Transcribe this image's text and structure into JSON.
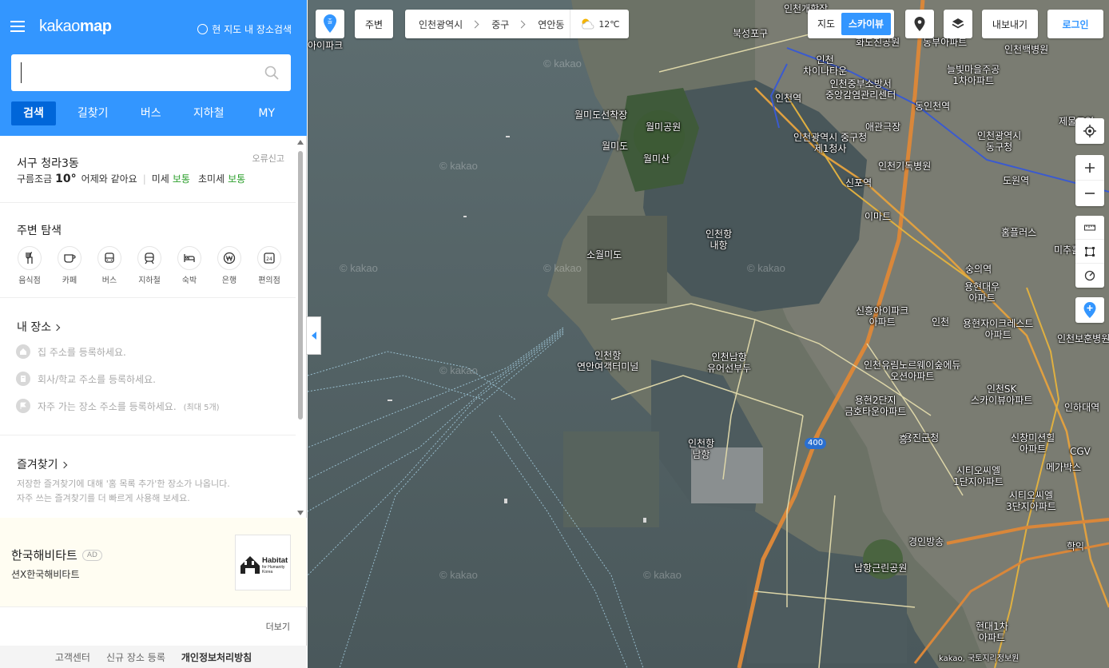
{
  "header": {
    "logo_light": "kakao",
    "logo_bold": "map",
    "current_area_search": "현 지도 내 장소검색",
    "search_placeholder": "",
    "tabs": [
      {
        "label": "검색"
      },
      {
        "label": "길찾기"
      },
      {
        "label": "버스"
      },
      {
        "label": "지하철"
      },
      {
        "label": "MY"
      }
    ]
  },
  "weather": {
    "location": "서구 청라3동",
    "report": "오류신고",
    "condition": "구름조금",
    "temp": "10°",
    "compare": "어제와 같아요",
    "dust_label": "미세",
    "dust_value": "보통",
    "ultra_label": "초미세",
    "ultra_value": "보통"
  },
  "nearby": {
    "title": "주변 탐색",
    "categories": [
      {
        "label": "음식점",
        "icon": "restaurant-icon"
      },
      {
        "label": "카페",
        "icon": "cafe-icon"
      },
      {
        "label": "버스",
        "icon": "bus-icon"
      },
      {
        "label": "지하철",
        "icon": "subway-icon"
      },
      {
        "label": "숙박",
        "icon": "lodging-icon"
      },
      {
        "label": "은행",
        "icon": "bank-icon"
      },
      {
        "label": "편의점",
        "icon": "convenience-store-icon"
      }
    ]
  },
  "my_places": {
    "title": "내 장소",
    "home": "집 주소를 등록하세요.",
    "work": "회사/학교 주소를 등록하세요.",
    "frequent": "자주 가는 장소 주소를 등록하세요.",
    "frequent_note": "(최대 5개)"
  },
  "favorites": {
    "title": "즐겨찾기",
    "desc1": "저장한 즐겨찾기에 대해 '홈 목록 추가'한 장소가 나옵니다.",
    "desc2": "자주 쓰는 즐겨찾기를 더 빠르게 사용해 보세요."
  },
  "ad": {
    "name": "한국해비타트",
    "badge": "AD",
    "sub": "션X한국해비타트",
    "logo_line1": "Habitat",
    "logo_line2": "for Humanity",
    "logo_line3": "Korea"
  },
  "more": "더보기",
  "footer": {
    "support": "고객센터",
    "new_place": "신규 장소 등록",
    "privacy": "개인정보처리방침"
  },
  "map_controls": {
    "pin_label": "출",
    "nearby": "주변",
    "breadcrumb": [
      "인천광역시",
      "중구",
      "연안동"
    ],
    "temp": "12℃",
    "mode_map": "지도",
    "mode_sky": "스카이뷰",
    "export": "내보내기",
    "login": "로그인"
  },
  "map_labels": [
    {
      "text": "북성포구"
    },
    {
      "text": "월미도선착장"
    },
    {
      "text": "월미공원"
    },
    {
      "text": "월미도"
    },
    {
      "text": "월미산"
    },
    {
      "text": "인천항\n내항"
    },
    {
      "text": "소월미도"
    },
    {
      "text": "인천항\n연안여객터미널"
    },
    {
      "text": "인천남항\n유어선부두"
    },
    {
      "text": "인천항\n남항"
    },
    {
      "text": "인천역"
    },
    {
      "text": "인천\n차이나타운"
    },
    {
      "text": "인천중부소방서\n중앙감염관리센터"
    },
    {
      "text": "동인천역"
    },
    {
      "text": "애관극장"
    },
    {
      "text": "인천광역시 중구청\n제1청사"
    },
    {
      "text": "인천기독병원"
    },
    {
      "text": "신포역"
    },
    {
      "text": "이마트"
    },
    {
      "text": "인천광역시\n동구청"
    },
    {
      "text": "도원역"
    },
    {
      "text": "홈플러스"
    },
    {
      "text": "숭의역"
    },
    {
      "text": "용현대우\n아파트"
    },
    {
      "text": "신흥아이파크\n아파트"
    },
    {
      "text": "인천"
    },
    {
      "text": "인천유림노르웨이숲에듀\n오션아파트"
    },
    {
      "text": "용현2단지\n금호타운아파트"
    },
    {
      "text": "인천SK\n스카이뷰아파트"
    },
    {
      "text": "인하대역"
    },
    {
      "text": "용현자이크레스트\n아파트"
    },
    {
      "text": "미추홀"
    },
    {
      "text": "인천보훈병원"
    },
    {
      "text": "용진군청"
    },
    {
      "text": "시티오씨엘\n1단지아파트"
    },
    {
      "text": "메가박스"
    },
    {
      "text": "시티오씨엘\n3단지아파트"
    },
    {
      "text": "경인방송"
    },
    {
      "text": "남항근린공원"
    },
    {
      "text": "현대1차\n아파트"
    },
    {
      "text": "신창미션힐\n아파트"
    },
    {
      "text": "인천백병원"
    },
    {
      "text": "인천개항장"
    },
    {
      "text": "늘빛마을주공\n1차아파트"
    },
    {
      "text": "제물포역"
    },
    {
      "text": "아이파크"
    },
    {
      "text": "화도진공원"
    },
    {
      "text": "동부아파트"
    },
    {
      "text": "400"
    },
    {
      "text": "학익"
    },
    {
      "text": "CGV"
    },
    {
      "text": "흥"
    },
    {
      "text": "kakao, 국토지리정보원"
    }
  ],
  "colors": {
    "brand_blue": "#3396ff",
    "active_tab": "#0066d9",
    "good_green": "#2da02d"
  }
}
